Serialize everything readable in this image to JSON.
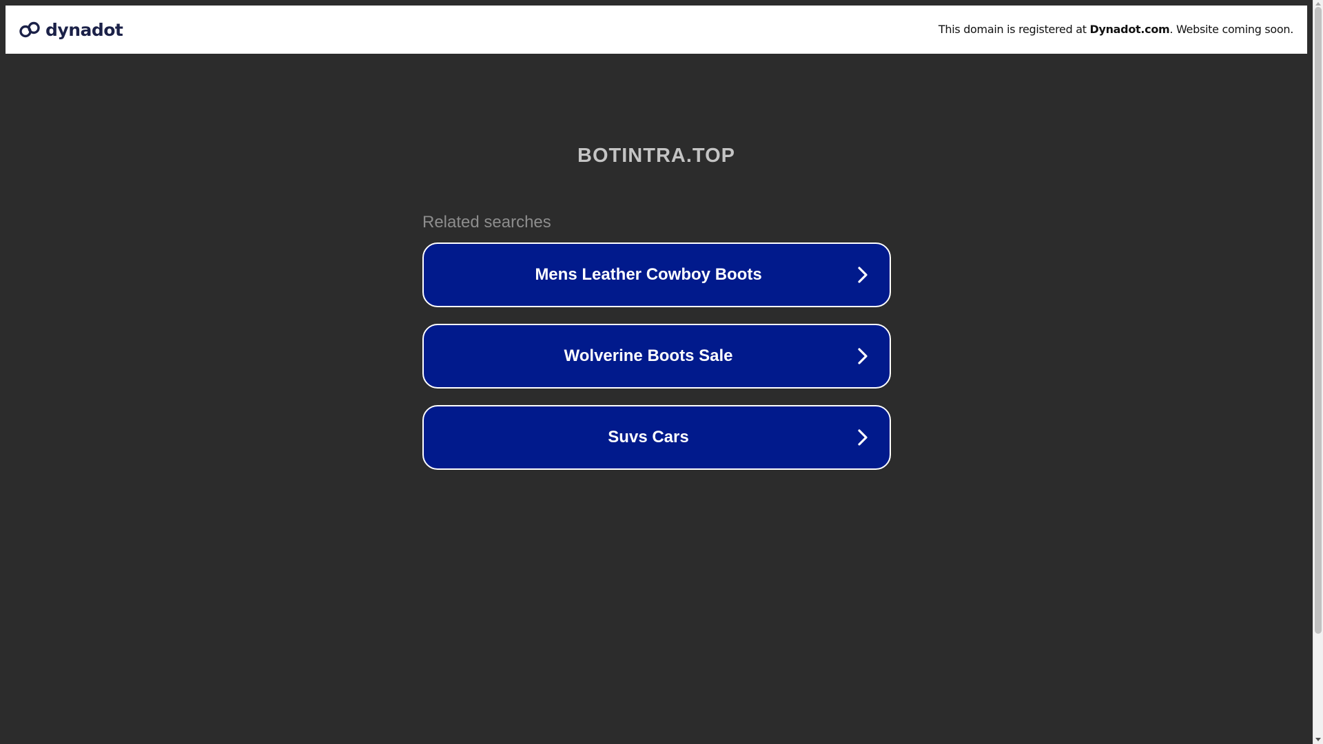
{
  "header": {
    "logo_text": "dynadot",
    "notice_prefix": "This domain is registered at ",
    "notice_brand": "Dynadot.com",
    "notice_suffix": ". Website coming soon."
  },
  "main": {
    "domain": "BOTINTRA.TOP",
    "related_heading": "Related searches",
    "searches": [
      {
        "label": "Mens Leather Cowboy Boots"
      },
      {
        "label": "Wolverine Boots Sale"
      },
      {
        "label": "Suvs Cars"
      }
    ]
  },
  "colors": {
    "background": "#2c2c2c",
    "button_fill": "#011a8c",
    "button_border": "#ffffff",
    "logo_color": "#1b2148"
  },
  "icons": {
    "logo": "dynadot-link-logo-icon",
    "button_arrow": "chevron-right-icon"
  }
}
